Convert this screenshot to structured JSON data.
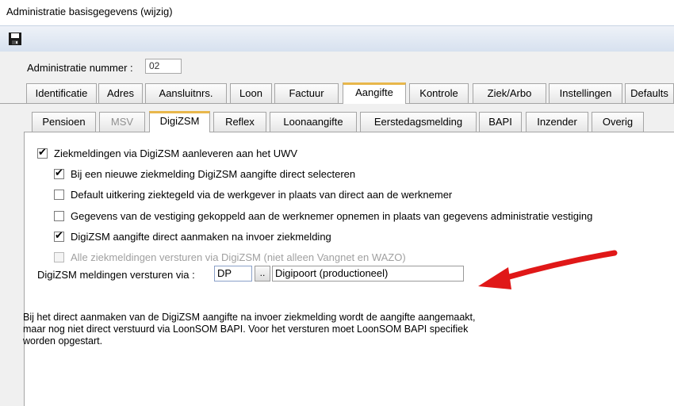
{
  "window": {
    "title": "Administratie basisgegevens  (wijzig)"
  },
  "toolbar": {
    "save_icon": "save-icon"
  },
  "admin": {
    "label": "Administratie nummer :",
    "value": "02"
  },
  "main_tabs": [
    {
      "label": "Identificatie",
      "active": false
    },
    {
      "label": "Adres",
      "active": false
    },
    {
      "label": "Aansluitnrs.",
      "active": false
    },
    {
      "label": "Loon",
      "active": false
    },
    {
      "label": "Factuur",
      "active": false
    },
    {
      "label": "Aangifte",
      "active": true
    },
    {
      "label": "Kontrole",
      "active": false
    },
    {
      "label": "Ziek/Arbo",
      "active": false
    },
    {
      "label": "Instellingen",
      "active": false
    },
    {
      "label": "Defaults",
      "active": false
    }
  ],
  "sub_tabs": [
    {
      "label": "Pensioen",
      "active": false,
      "disabled": false
    },
    {
      "label": "MSV",
      "active": false,
      "disabled": true
    },
    {
      "label": "DigiZSM",
      "active": true,
      "disabled": false
    },
    {
      "label": "Reflex",
      "active": false,
      "disabled": false
    },
    {
      "label": "Loonaangifte",
      "active": false,
      "disabled": false
    },
    {
      "label": "Eerstedagsmelding",
      "active": false,
      "disabled": false
    },
    {
      "label": "BAPI",
      "active": false,
      "disabled": false
    },
    {
      "label": "Inzender",
      "active": false,
      "disabled": false
    },
    {
      "label": "Overig",
      "active": false,
      "disabled": false
    }
  ],
  "options": [
    {
      "label": "Ziekmeldingen via DigiZSM aanleveren aan het UWV",
      "checked": true,
      "disabled": false
    },
    {
      "label": "Bij een nieuwe ziekmelding DigiZSM aangifte direct selecteren",
      "checked": true,
      "disabled": false
    },
    {
      "label": "Default uitkering ziektegeld via de werkgever in plaats van direct aan de werknemer",
      "checked": false,
      "disabled": false
    },
    {
      "label": "Gegevens van de vestiging gekoppeld aan de werknemer opnemen in plaats van gegevens administratie vestiging",
      "checked": false,
      "disabled": false
    },
    {
      "label": "DigiZSM aangifte direct aanmaken na invoer ziekmelding",
      "checked": true,
      "disabled": false
    },
    {
      "label": "Alle ziekmeldingen versturen via DigiZSM (niet alleen Vangnet en WAZO)",
      "checked": false,
      "disabled": true
    }
  ],
  "send_via": {
    "label": "DigiZSM meldingen versturen via :",
    "code": "DP",
    "lookup_label": "..",
    "description": "Digipoort (productioneel)"
  },
  "info_lines": [
    "Bij het direct aanmaken van de DigiZSM aangifte na invoer ziekmelding wordt de aangifte aangemaakt,",
    "maar nog niet direct verstuurd via LoonSOM BAPI. Voor het versturen moet LoonSOM BAPI specifiek",
    "worden opgestart."
  ],
  "annotation": {
    "arrow_color": "#e01818"
  }
}
